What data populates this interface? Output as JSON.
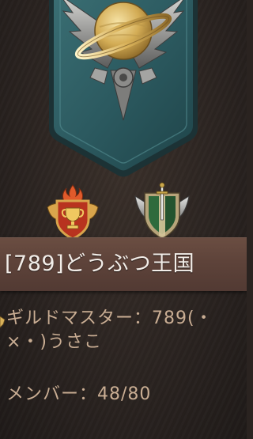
{
  "guild": {
    "name": "[789]どうぶつ王国",
    "master_label": "ギルドマスター：",
    "master_name": "789(・×・)うさこ",
    "member_label": "メンバー：",
    "member_count": "48/80"
  },
  "icons": {
    "banner": "guild-banner-saturn-emblem",
    "rank": "trophy-rank-badge",
    "faction": "sword-shield-faction-badge"
  },
  "colors": {
    "banner_teal": "#2c5a60",
    "plate_brown": "#5e433a",
    "info_text": "#c9ad93",
    "name_text": "#f2ede8",
    "gold": "#d9b25a",
    "rank_red": "#b8331f",
    "faction_green": "#2e6a3c"
  }
}
